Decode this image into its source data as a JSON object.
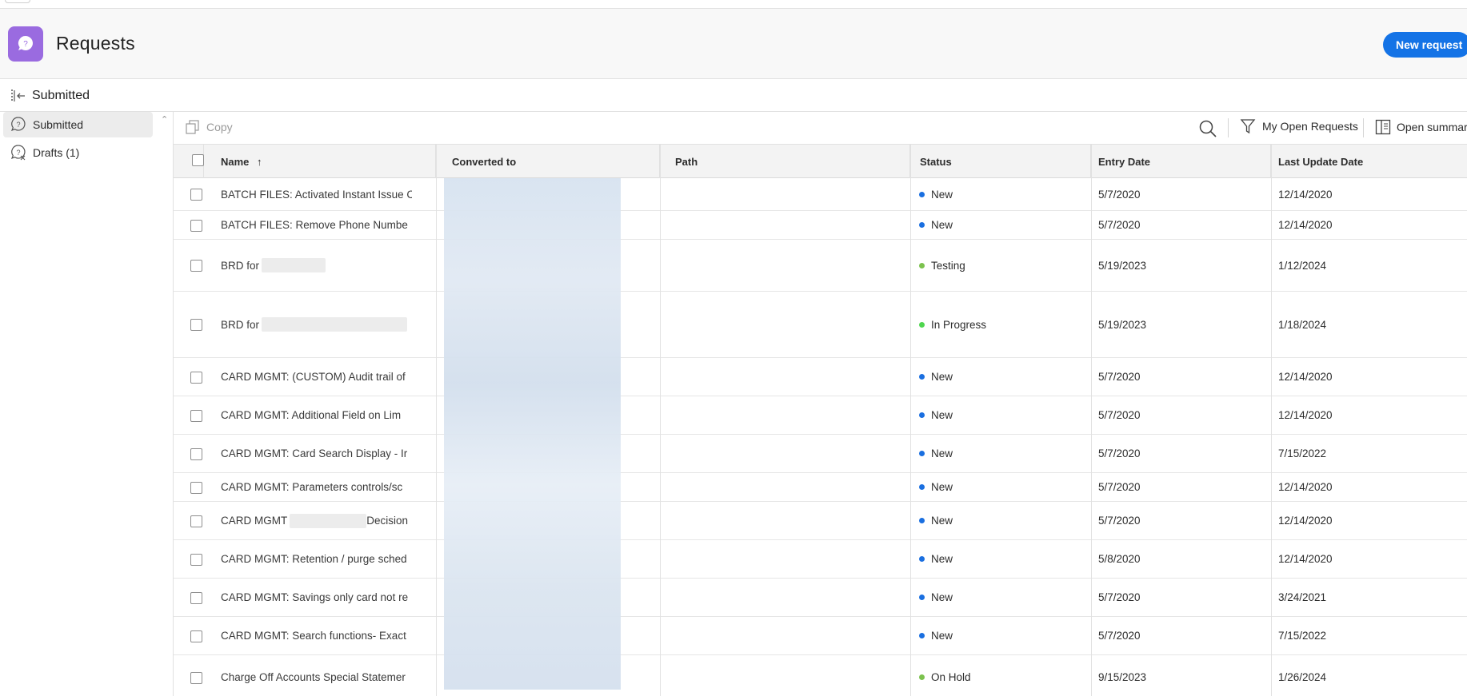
{
  "header": {
    "title": "Requests",
    "new_request_label": "New request",
    "logo_glyph": "?"
  },
  "subbar": {
    "title": "Submitted"
  },
  "sidebar": {
    "items": [
      {
        "label": "Submitted",
        "icon": "question-bubble-icon",
        "active": true
      },
      {
        "label": "Drafts (1)",
        "icon": "draft-person-icon",
        "active": false
      }
    ]
  },
  "toolbar": {
    "copy_label": "Copy",
    "filter_label": "My Open Requests",
    "summary_label": "Open summary"
  },
  "columns": {
    "name": "Name",
    "name_sort": "↑",
    "converted_to": "Converted to",
    "path": "Path",
    "status": "Status",
    "entry_date": "Entry Date",
    "last_update": "Last Update Date"
  },
  "colors": {
    "accent": "#1473e6",
    "logo": "#9a6be0",
    "status_new": "#1a6fe0",
    "status_testing": "#7cc24e",
    "status_in_progress": "#4fd64f",
    "status_on_hold": "#7cc24e"
  },
  "rows": [
    {
      "name": "BATCH FILES: Activated Instant Issue C",
      "status": "New",
      "entry": "5/7/2020",
      "updated": "12/14/2020"
    },
    {
      "name": "BATCH FILES: Remove Phone Numbe",
      "status": "New",
      "entry": "5/7/2020",
      "updated": "12/14/2020"
    },
    {
      "name": "BRD for",
      "status": "Testing",
      "entry": "5/19/2023",
      "updated": "1/12/2024"
    },
    {
      "name": "BRD for",
      "status": "In Progress",
      "entry": "5/19/2023",
      "updated": "1/18/2024"
    },
    {
      "name": "CARD MGMT: (CUSTOM) Audit trail of",
      "status": "New",
      "entry": "5/7/2020",
      "updated": "12/14/2020"
    },
    {
      "name": "CARD MGMT: Additional Field on Lim",
      "status": "New",
      "entry": "5/7/2020",
      "updated": "12/14/2020"
    },
    {
      "name": "CARD MGMT: Card Search Display - Ir",
      "status": "New",
      "entry": "5/7/2020",
      "updated": "7/15/2022"
    },
    {
      "name": "CARD MGMT: Parameters controls/sc",
      "status": "New",
      "entry": "5/7/2020",
      "updated": "12/14/2020"
    },
    {
      "name": "CARD MGMT",
      "name_suffix": "Decision",
      "status": "New",
      "entry": "5/7/2020",
      "updated": "12/14/2020"
    },
    {
      "name": "CARD MGMT: Retention / purge sched",
      "status": "New",
      "entry": "5/8/2020",
      "updated": "12/14/2020"
    },
    {
      "name": "CARD MGMT: Savings only card not re",
      "status": "New",
      "entry": "5/7/2020",
      "updated": "3/24/2021"
    },
    {
      "name": "CARD MGMT: Search functions- Exact",
      "status": "New",
      "entry": "5/7/2020",
      "updated": "7/15/2022"
    },
    {
      "name": "Charge Off Accounts Special Statemer",
      "status": "On Hold",
      "entry": "9/15/2023",
      "updated": "1/26/2024"
    }
  ]
}
